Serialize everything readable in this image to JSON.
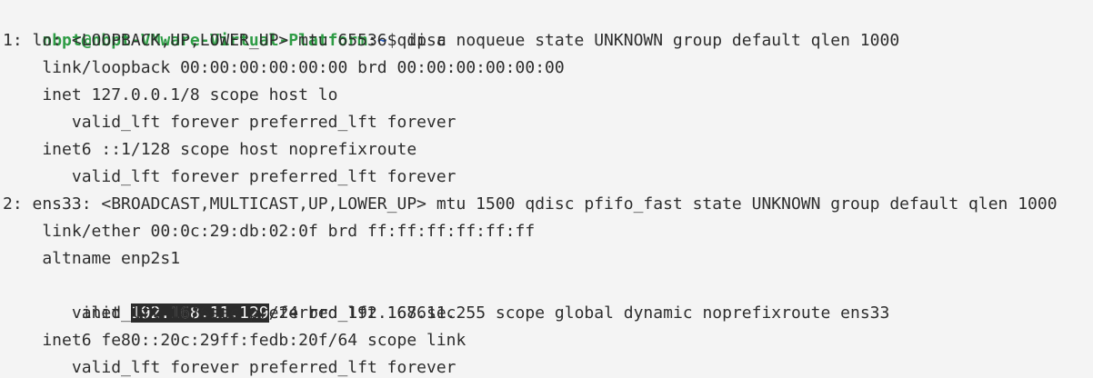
{
  "terminal": {
    "colors": {
      "background": "#f4f4f4",
      "text": "#2d2d2d",
      "prompt_user": "#2e9c45",
      "prompt_path": "#2f63c8",
      "selection_bg": "#2b2b2b"
    },
    "prompt": {
      "user_host": "nbpt@nbpt-VMware-Virtual-Platform",
      "colon": ":",
      "path": "~",
      "symbol": "$ ",
      "command": "ip a"
    },
    "lines": {
      "l1": "1: lo: <LOOPBACK,UP,LOWER_UP> mtu 65536 qdisc noqueue state UNKNOWN group default qlen 1000",
      "l2": "    link/loopback 00:00:00:00:00:00 brd 00:00:00:00:00:00",
      "l3": "    inet 127.0.0.1/8 scope host lo",
      "l4": "       valid_lft forever preferred_lft forever",
      "l5": "    inet6 ::1/128 scope host noprefixroute",
      "l6": "       valid_lft forever preferred_lft forever",
      "l7": "2: ens33: <BROADCAST,MULTICAST,UP,LOWER_UP> mtu 1500 qdisc pfifo_fast state UNKNOWN group default qlen 1000",
      "l8": "    link/ether 00:0c:29:db:02:0f brd ff:ff:ff:ff:ff:ff",
      "l9": "    altname enp2s1",
      "l10_pre": "    inet ",
      "l10_sel": "192.168.11.129",
      "l10_post": "/24 brd 192.168.11.255 scope global dynamic noprefixroute ens33",
      "l11": "       valid_lft 1676sec preferred_lft 1676sec",
      "l12": "    inet6 fe80::20c:29ff:fedb:20f/64 scope link",
      "l13": "       valid_lft forever preferred_lft forever"
    }
  }
}
